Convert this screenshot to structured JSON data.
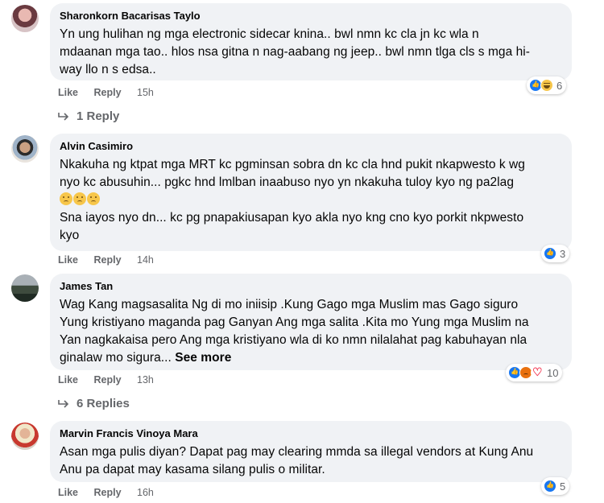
{
  "comments": [
    {
      "author": "Sharonkorn Bacarisas Taylo",
      "text_lines": [
        "Yn ung hulihan ng mga electronic sidecar knina.. bwl nmn kc cla jn kc wla n",
        "mdaanan mga tao.. hlos nsa gitna n nag-aabang ng jeep.. bwl nmn tlga cls s mga hi-",
        "way llo n s edsa.."
      ],
      "like_label": "Like",
      "reply_label": "Reply",
      "time": "15h",
      "reactions": [
        "like",
        "haha"
      ],
      "reaction_count": "6",
      "replies_label": "1 Reply"
    },
    {
      "author": "Alvin Casimiro",
      "text_lines": [
        "Nkakuha ng ktpat mga MRT kc pgminsan sobra dn kc cla hnd pukit nkapwesto k wg",
        "nyo kc abusuhin... pgkc hnd lmlban inaabuso nyo yn nkakuha tuloy kyo ng pa2lag"
      ],
      "emoji_count": 3,
      "text_lines_2": [
        "Sna iayos nyo dn... kc pg pnapakiusapan kyo akla nyo kng cno kyo porkit nkpwesto",
        "kyo"
      ],
      "like_label": "Like",
      "reply_label": "Reply",
      "time": "14h",
      "reactions": [
        "like"
      ],
      "reaction_count": "3"
    },
    {
      "author": "James Tan",
      "text_lines": [
        "Wag Kang magsasalita Ng di mo iniisip .Kung Gago mga Muslim mas Gago siguro",
        "Yung kristiyano maganda pag Ganyan Ang mga salita .Kita mo Yung mga Muslim na",
        "Yan nagkakaisa pero Ang mga kristiyano wla di ko nmn nilalahat pag kabuhayan nla",
        "ginalaw mo sigura..."
      ],
      "see_more": "See more",
      "like_label": "Like",
      "reply_label": "Reply",
      "time": "13h",
      "reactions": [
        "like",
        "angry",
        "love"
      ],
      "reaction_count": "10",
      "replies_label": "6 Replies"
    },
    {
      "author": "Marvin Francis Vinoya Mara",
      "text_lines": [
        "Asan mga pulis diyan? Dapat pag may clearing mmda sa illegal vendors at Kung Anu",
        "Anu pa dapat may kasama silang pulis o militar."
      ],
      "like_label": "Like",
      "reply_label": "Reply",
      "time": "16h",
      "reactions": [
        "like"
      ],
      "reaction_count": "5"
    }
  ]
}
